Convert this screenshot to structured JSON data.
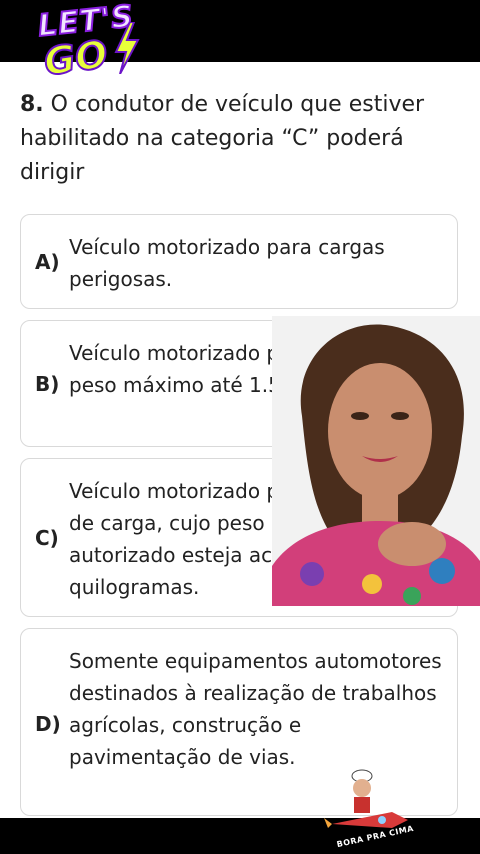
{
  "logo": {
    "line1": "LET'S",
    "line2": "GO"
  },
  "question": {
    "number": "8.",
    "text": "O condutor de veículo que estiver habilitado na categoria “C” poderá dirigir"
  },
  "options": [
    {
      "letter": "A)",
      "text": "Veículo motorizado para cargas perigosas."
    },
    {
      "letter": "B)",
      "text": "Veículo motorizado para carga, de peso máximo até 1.500 quilogramas."
    },
    {
      "letter": "C)",
      "text": "Veículo motorizado para transporte de carga, cujo peso máximo autorizado esteja acima de 3.500 quilogramas."
    },
    {
      "letter": "D)",
      "text": "Somente equipamentos automotores destinados à realização de trabalhos agrícolas, construção e pavimentação de vias."
    }
  ],
  "mascot": {
    "brand": "BORA PRA CIMA"
  },
  "colors": {
    "logo_purple": "#8a1fe0",
    "logo_yellow": "#e8ff3a",
    "card_border": "#d9d9d9"
  }
}
